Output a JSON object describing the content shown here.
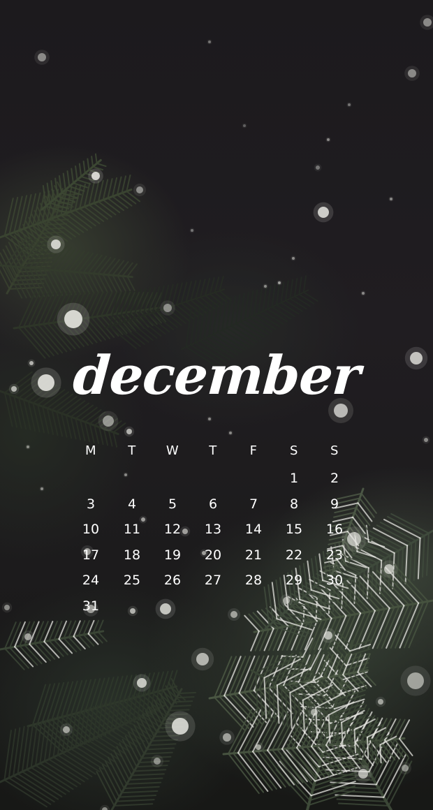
{
  "calendar": {
    "month": "december",
    "weekdays": [
      "M",
      "T",
      "W",
      "T",
      "F",
      "S",
      "S"
    ],
    "weeks": [
      [
        "",
        "",
        "",
        "",
        "",
        "1",
        "2"
      ],
      [
        "3",
        "4",
        "5",
        "6",
        "7",
        "8",
        "9"
      ],
      [
        "10",
        "11",
        "12",
        "13",
        "14",
        "15",
        "16"
      ],
      [
        "17",
        "18",
        "19",
        "20",
        "21",
        "22",
        "23"
      ],
      [
        "24",
        "25",
        "26",
        "27",
        "28",
        "29",
        "30"
      ],
      [
        "31",
        "",
        "",
        "",
        "",
        "",
        ""
      ]
    ]
  },
  "colors": {
    "background": "#1d1b1e",
    "text": "#ffffff",
    "pine": "#3f4a3c",
    "snow": "#e6e6e0"
  }
}
